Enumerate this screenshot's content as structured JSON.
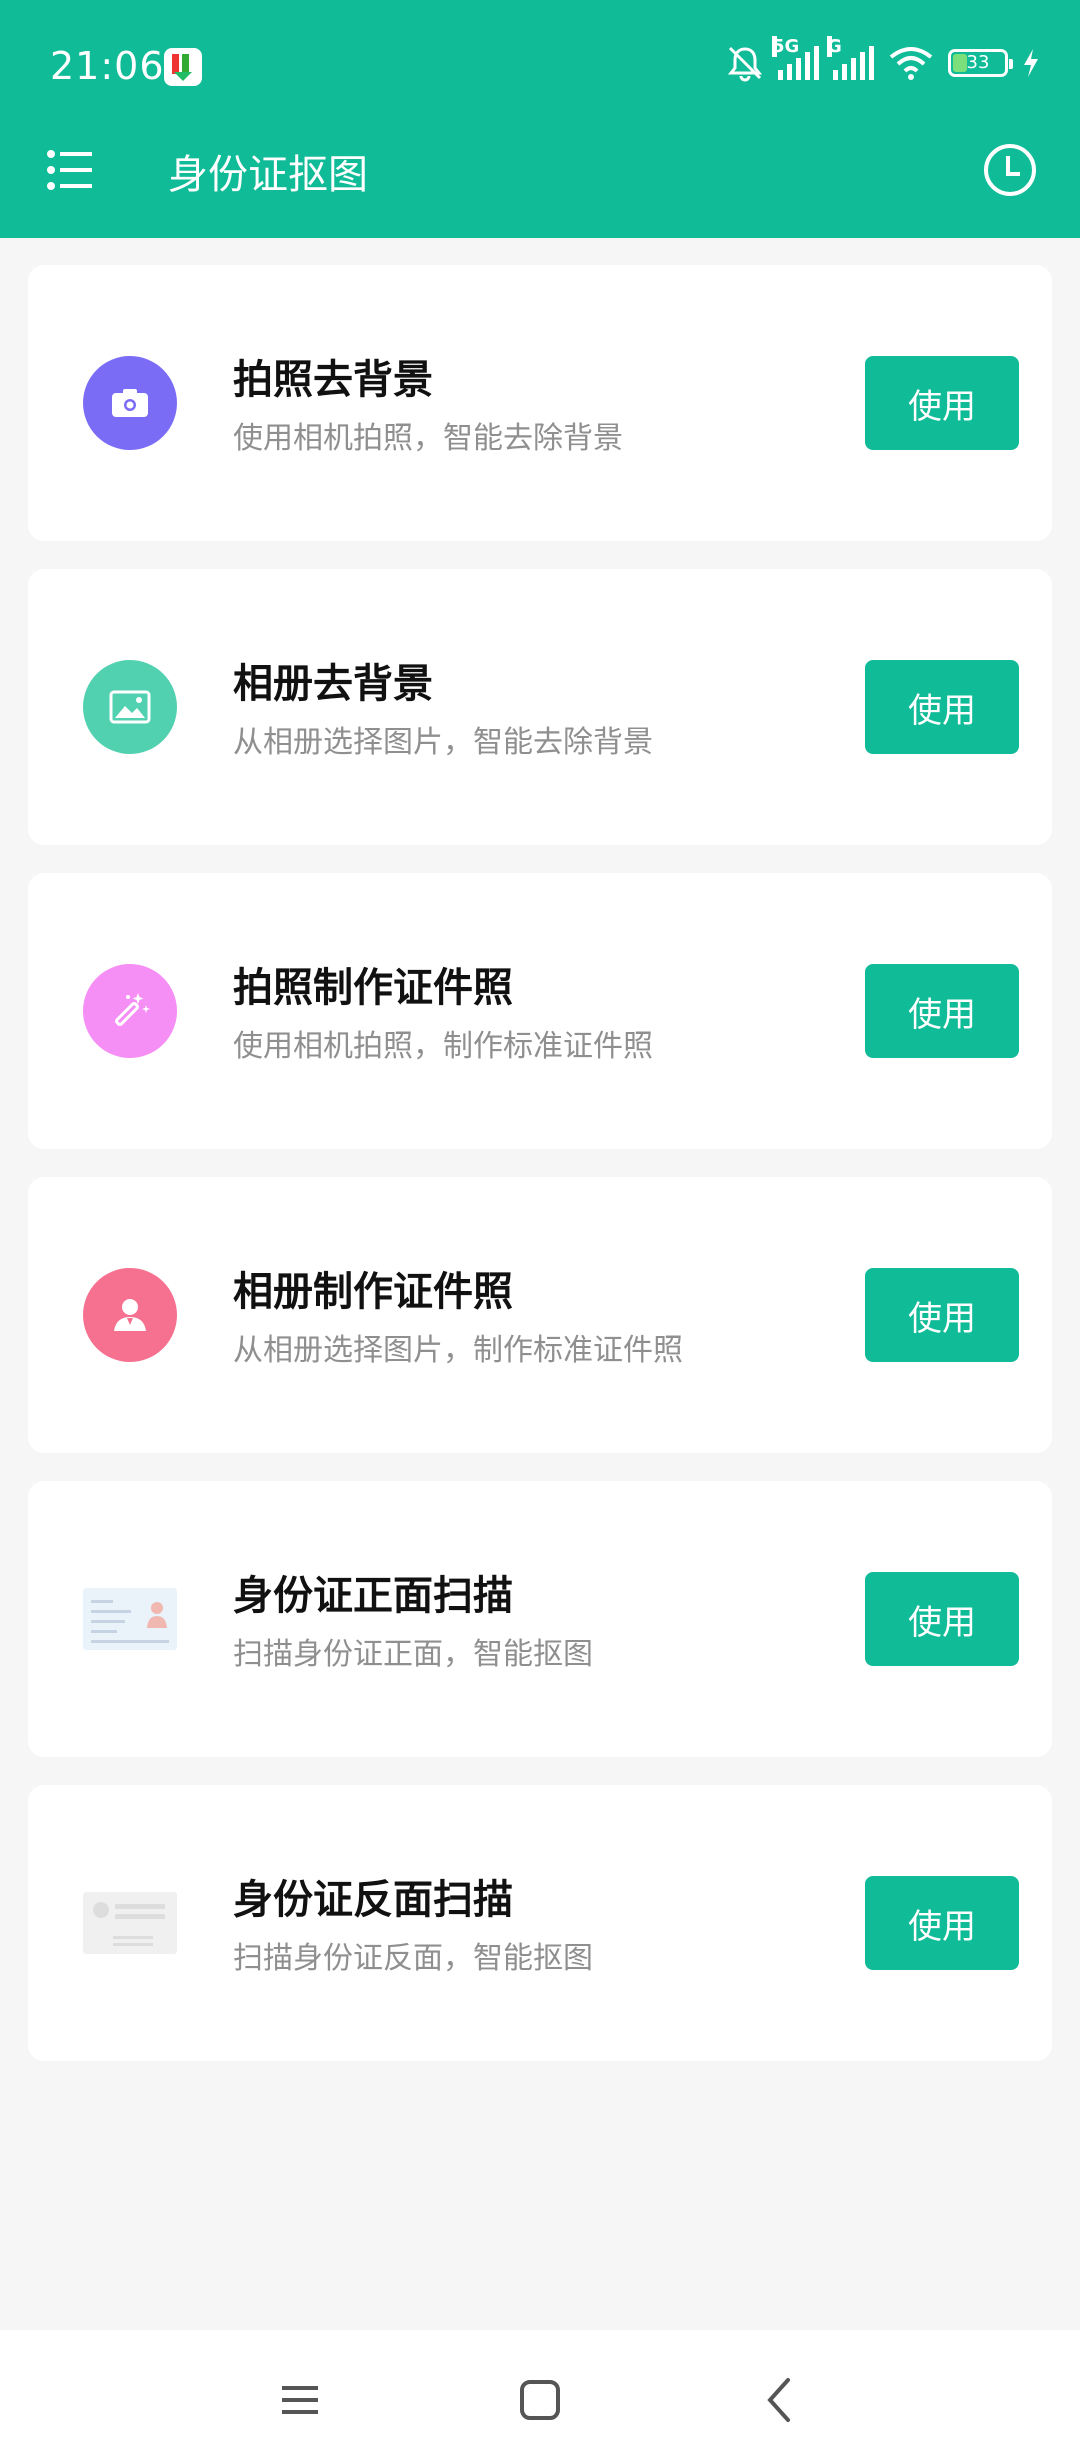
{
  "status_bar": {
    "time": "21:06",
    "battery_level": "33",
    "network_1": "5G",
    "network_2": "G"
  },
  "header": {
    "title": "身份证抠图"
  },
  "items": [
    {
      "title": "拍照去背景",
      "description": "使用相机拍照，智能去除背景",
      "button_label": "使用",
      "icon": "camera-icon",
      "color": "#7b6cf6"
    },
    {
      "title": "相册去背景",
      "description": "从相册选择图片，智能去除背景",
      "button_label": "使用",
      "icon": "image-icon",
      "color": "#52d1b0"
    },
    {
      "title": "拍照制作证件照",
      "description": "使用相机拍照，制作标准证件照",
      "button_label": "使用",
      "icon": "magic-wand-icon",
      "color": "#f58ef5"
    },
    {
      "title": "相册制作证件照",
      "description": "从相册选择图片，制作标准证件照",
      "button_label": "使用",
      "icon": "person-icon",
      "color": "#f6708f"
    },
    {
      "title": "身份证正面扫描",
      "description": "扫描身份证正面，智能抠图",
      "button_label": "使用",
      "icon": "id-card-front-icon",
      "color": "#eaf2fa"
    },
    {
      "title": "身份证反面扫描",
      "description": "扫描身份证反面，智能抠图",
      "button_label": "使用",
      "icon": "id-card-back-icon",
      "color": "#f0f0f0"
    }
  ],
  "colors": {
    "primary": "#10bb97",
    "background": "#f6f6f6"
  }
}
